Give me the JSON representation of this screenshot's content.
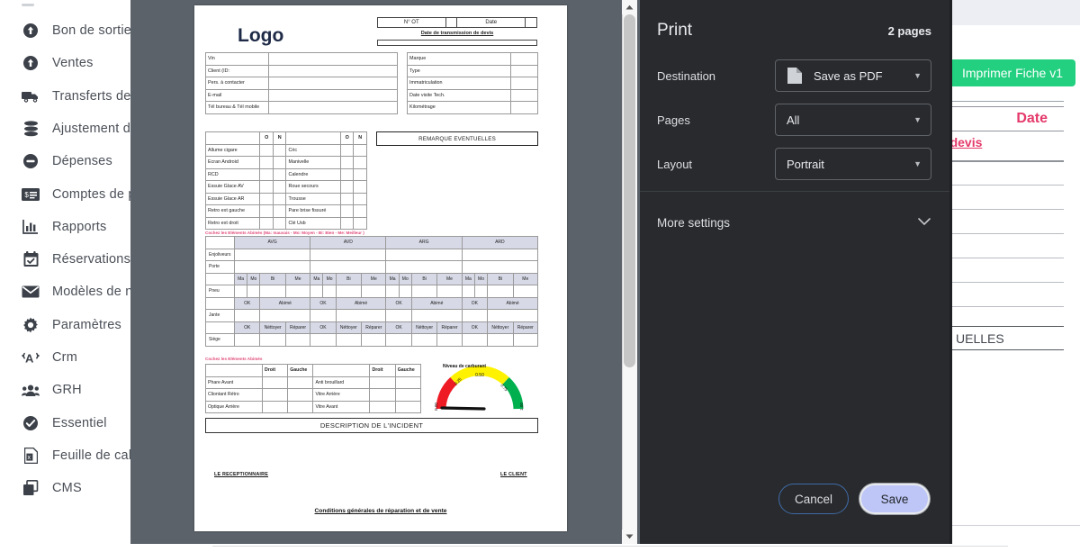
{
  "sidebar": {
    "items": [
      {
        "label": "Bon de sortie",
        "icon": "upload-circle-icon"
      },
      {
        "label": "Ventes",
        "icon": "upload-circle-icon"
      },
      {
        "label": "Transferts de stoc",
        "icon": "truck-icon"
      },
      {
        "label": "Ajustement des st",
        "icon": "database-icon"
      },
      {
        "label": "Dépenses",
        "icon": "minus-circle-icon"
      },
      {
        "label": "Comptes de paiem",
        "icon": "payment-card-icon"
      },
      {
        "label": "Rapports",
        "icon": "bar-chart-icon"
      },
      {
        "label": "Réservations",
        "icon": "calendar-check-icon"
      },
      {
        "label": "Modèles de notific",
        "icon": "envelope-icon"
      },
      {
        "label": "Paramètres",
        "icon": "gear-icon"
      },
      {
        "label": "Crm",
        "icon": "broadcast-icon"
      },
      {
        "label": "GRH",
        "icon": "people-icon"
      },
      {
        "label": "Essentiel",
        "icon": "check-circle-icon"
      },
      {
        "label": "Feuille de calcul",
        "icon": "excel-file-icon"
      },
      {
        "label": "CMS",
        "icon": "layers-icon"
      }
    ]
  },
  "background_page": {
    "print_button_label": "Imprimer Fiche v1",
    "date_label": "Date",
    "devis_link": "le devis",
    "remarque_partial": "UELLES",
    "bottom_note": "Cochez les Eléments Abimés (Ma: mauvais - Mo: Moyen - Bi: Bien - Me: Meilleur )",
    "scroll_top_icon": "chevron-up-icon",
    "accent_green": "#22d07f",
    "accent_pink": "#e5396a"
  },
  "print_dialog": {
    "title": "Print",
    "pages_count": "2 pages",
    "fields": [
      {
        "label": "Destination",
        "value": "Save as PDF",
        "icon": "pdf-file-icon"
      },
      {
        "label": "Pages",
        "value": "All",
        "icon": ""
      },
      {
        "label": "Layout",
        "value": "Portrait",
        "icon": ""
      }
    ],
    "more_settings_label": "More settings",
    "more_settings_icon": "chevron-down-icon",
    "cancel_label": "Cancel",
    "save_label": "Save",
    "bg_color": "#292a2d",
    "save_bg": "#bdc6f7"
  },
  "document": {
    "logo": "Logo",
    "header_cells": [
      "N° OT",
      "",
      "Date",
      ""
    ],
    "transmission_label": "Date de transmission de devis",
    "left_table": [
      [
        "Vin",
        ""
      ],
      [
        "Client (ID:",
        ""
      ],
      [
        "Pers. à contacter",
        ""
      ],
      [
        "E-mail",
        ""
      ],
      [
        "Tél bureau & Tél mobile",
        ""
      ]
    ],
    "right_table": [
      [
        "Marque",
        ""
      ],
      [
        "Type",
        ""
      ],
      [
        "Immatriculation",
        ""
      ],
      [
        "Date visite Tech.",
        ""
      ],
      [
        "Kilométrage",
        ""
      ]
    ],
    "options_header": [
      "",
      "O",
      "N",
      "",
      "O",
      "N"
    ],
    "options_rows": [
      [
        "Allume cigare",
        "Cric"
      ],
      [
        "Ecran Android",
        "Manivelle"
      ],
      [
        "RCD",
        "Calendre"
      ],
      [
        "Essuie Glace AV",
        "Roue secours"
      ],
      [
        "Essuie Glace AR",
        "Trousse"
      ],
      [
        "Retro ext gauche",
        "Pare brise fissuré"
      ],
      [
        "Retro ext droit",
        "Clé Usb"
      ]
    ],
    "remarque_box": "REMARQUE EVENTUELLES",
    "note_red_1": "Cochez les Eléments Abimés (Ma: mauvais - Mo: Moyen - Bi: Bien - Me: Meilleur )",
    "note_red_2": "Cochez les Eléments Abimés",
    "abimes_positions": [
      "AVG",
      "AVD",
      "ARG",
      "ARD"
    ],
    "abimes_rows": [
      "Enjoliveurs",
      "Porte",
      "Pneu",
      "Jante",
      "Siège"
    ],
    "abimes_grades": [
      "Ma",
      "Mo",
      "Bi",
      "Me"
    ],
    "abimes_ok_abime": [
      "OK",
      "Abimé"
    ],
    "abimes_ok_nett_rep": [
      "OK",
      "Néttoyer",
      "Réparer"
    ],
    "phares_header": [
      "",
      "Droit",
      "Gauche",
      "",
      "Droit",
      "Gauche"
    ],
    "phares_rows": [
      [
        "Phare Avant",
        "Anti brouillard"
      ],
      [
        "Cliontant Rétro",
        "Vitre Arrière"
      ],
      [
        "Optique Arrière",
        "Vitre Avant"
      ]
    ],
    "gauge": {
      "title": "Niveau de carburant",
      "ticks": [
        "0.00",
        "0.25",
        "0.50",
        "0.75",
        "1.00"
      ],
      "value": 0.0,
      "colors": [
        "#ee1b24",
        "#fff200",
        "#00b04f"
      ]
    },
    "description_incident": "DESCRIPTION DE L'INCIDENT",
    "signature_left": "LE RECEPTIONNAIRE",
    "signature_right": "LE CLIENT",
    "cgv": "Conditions générales de réparation et de vente"
  }
}
